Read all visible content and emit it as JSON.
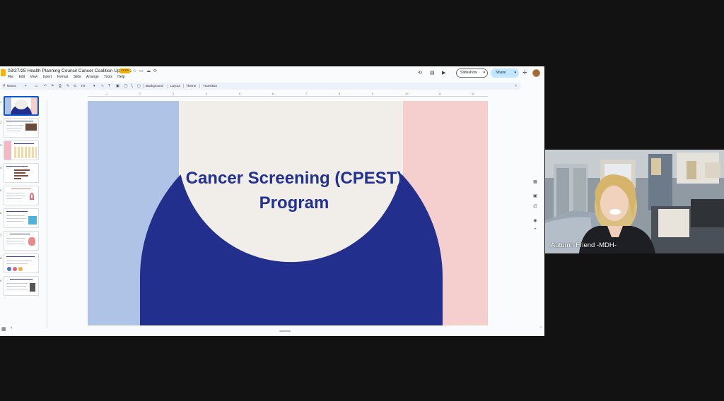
{
  "presentation": {
    "title": "03/27/25 Health Planning Council Cancer Coalition Updates",
    "badge": "CCCP",
    "menu": [
      "File",
      "Edit",
      "View",
      "Insert",
      "Format",
      "Slide",
      "Arrange",
      "Tools",
      "Help"
    ],
    "slideshow_label": "Slideshow",
    "share_label": "Share"
  },
  "toolbar": {
    "menus_label": "Menus",
    "zoom_label": "Fit",
    "background_label": "Background",
    "layout_label": "Layout",
    "theme_label": "Theme",
    "transition_label": "Transition"
  },
  "ruler": [
    "1",
    "2",
    "3",
    "4",
    "5",
    "6",
    "7",
    "8",
    "9",
    "10",
    "11",
    "12"
  ],
  "filmstrip": {
    "thumbs": [
      "1",
      "2",
      "3",
      "4",
      "5",
      "6",
      "7",
      "8",
      "9"
    ]
  },
  "slide": {
    "title": "Cancer Screening (CPEST) Program",
    "colors": {
      "left_panel": "#aec3e6",
      "right_panel": "#f5cfcd",
      "arch": "#232f8d",
      "circle": "#f1eeea",
      "background": "#f8f7f4",
      "title": "#22318f"
    }
  },
  "participant": {
    "name": "Autumn Friend -MDH-"
  }
}
